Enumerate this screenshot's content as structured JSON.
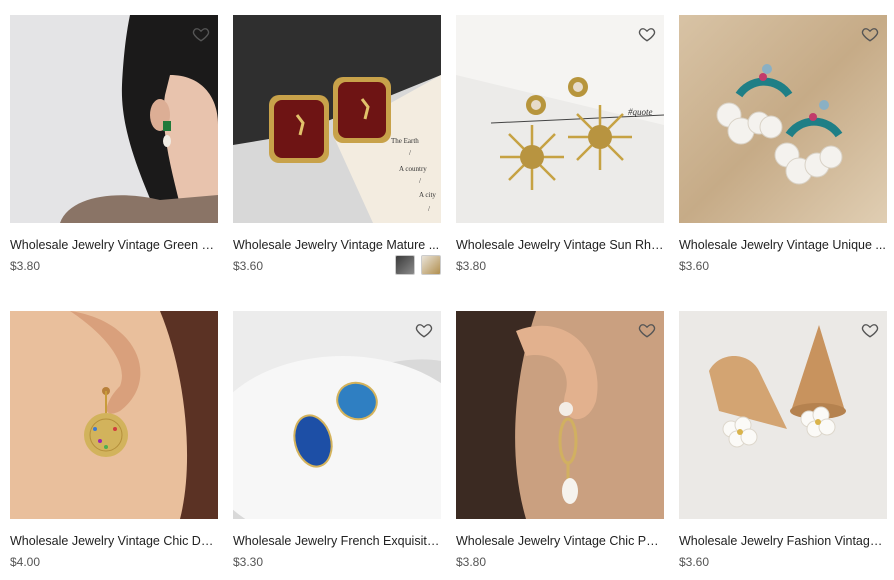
{
  "products": [
    {
      "title": "Wholesale Jewelry Vintage Green G...",
      "price": "$3.80",
      "favorite_icon": "heart-outline-icon"
    },
    {
      "title": "Wholesale Jewelry Vintage Mature ...",
      "price": "$3.60",
      "favorite_icon": "heart-outline-icon",
      "color_swatches": [
        "dark",
        "gold"
      ]
    },
    {
      "title": "Wholesale Jewelry Vintage Sun Rhi...",
      "price": "$3.80",
      "favorite_icon": "heart-outline-icon"
    },
    {
      "title": "Wholesale Jewelry Vintage Unique ...",
      "price": "$3.60",
      "favorite_icon": "heart-outline-icon"
    },
    {
      "title": "Wholesale Jewelry Vintage Chic De...",
      "price": "$4.00",
      "favorite_icon": "heart-outline-icon"
    },
    {
      "title": "Wholesale Jewelry French Exquisite...",
      "price": "$3.30",
      "favorite_icon": "heart-outline-icon"
    },
    {
      "title": "Wholesale Jewelry Vintage Chic Pea...",
      "price": "$3.80",
      "favorite_icon": "heart-outline-icon"
    },
    {
      "title": "Wholesale Jewelry Fashion Vintage ...",
      "price": "$3.60",
      "favorite_icon": "heart-outline-icon"
    }
  ],
  "image_text": {
    "card2": [
      "The Earth",
      "/",
      "A country",
      "/",
      "A city",
      "/"
    ],
    "card3": "#quote"
  },
  "colors": {
    "text": "#222222",
    "price": "#555555",
    "heart": "#555555"
  }
}
